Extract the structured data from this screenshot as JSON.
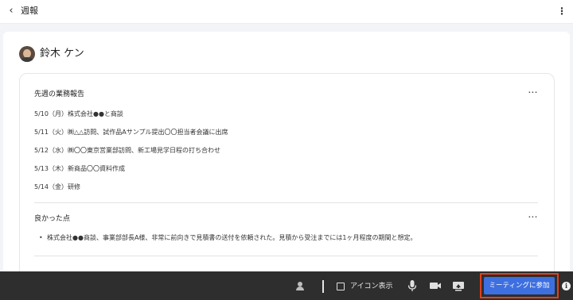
{
  "header": {
    "back_icon": "chevron-left-icon",
    "title": "週報",
    "menu_icon": "more-vert-icon"
  },
  "author": {
    "name": "鈴木 ケン",
    "avatar_icon": "avatar"
  },
  "report": {
    "sections": [
      {
        "title": "先週の業務報告",
        "entries": [
          "5/10（月）株式会社●●と商談",
          "5/11（火）㈱△△訪問、試作品Aサンプル提出〇〇担当者会議に出席",
          "5/12（水）㈱〇〇東京営業部訪問、新工場見学日程の打ち合わせ",
          "5/13（木）新商品〇〇資料作成",
          "5/14（金）研修"
        ]
      },
      {
        "title": "良かった点",
        "bullets": [
          "株式会社●●商談、事業部部長A様、非常に前向きで見積書の送付を依頼された。見積から受注までには1ヶ月程度の期間と想定。"
        ]
      }
    ],
    "more_label": "···"
  },
  "toolbar": {
    "icon_toggle_label": "アイコン表示",
    "join_label": "ミーティングに参加",
    "info_label": "i"
  },
  "colors": {
    "join_button": "#3d6fe0",
    "join_highlight": "#e0411f",
    "toolbar_bg": "#2e2e2e"
  }
}
